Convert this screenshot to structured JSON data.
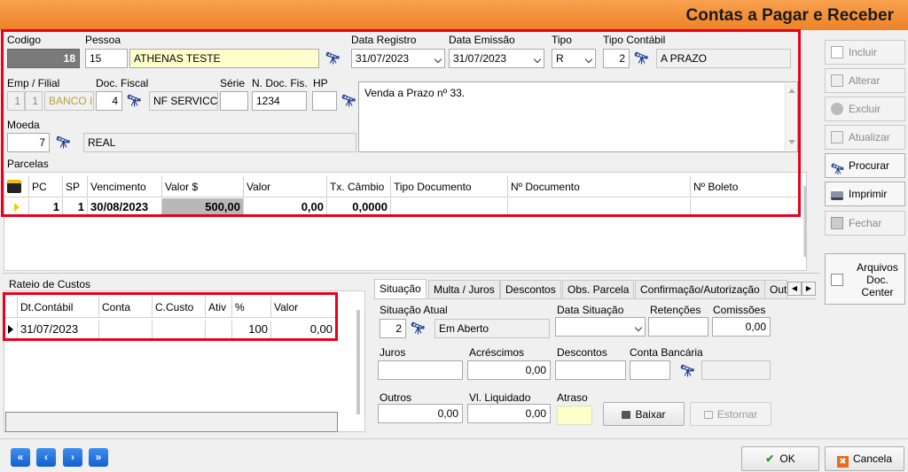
{
  "window": {
    "title": "Contas a Pagar e Receber"
  },
  "header": {
    "codigo": {
      "label": "Codigo",
      "value": "18"
    },
    "pessoa": {
      "label": "Pessoa",
      "code": "15",
      "name": "ATHENAS TESTE"
    },
    "data_registro": {
      "label": "Data Registro",
      "value": "31/07/2023"
    },
    "data_emissao": {
      "label": "Data Emissão",
      "value": "31/07/2023"
    },
    "tipo": {
      "label": "Tipo",
      "value": "R"
    },
    "tipo_contabil": {
      "label": "Tipo Contábil",
      "code": "2",
      "name": "A PRAZO"
    },
    "emp_filial": {
      "label": "Emp / Filial",
      "emp": "1",
      "filial": "1",
      "name": "BANCO I"
    },
    "doc_fiscal": {
      "label": "Doc. Fiscal",
      "code": "4",
      "name": "NF SERVICC"
    },
    "serie": {
      "label": "Série",
      "value": ""
    },
    "n_doc_fis": {
      "label": "N. Doc. Fis.",
      "value": "1234"
    },
    "hp": {
      "label": "HP",
      "value": ""
    },
    "descricao": "Venda a Prazo nº 33.",
    "moeda": {
      "label": "Moeda",
      "code": "7",
      "name": "REAL"
    }
  },
  "parcelas": {
    "label": "Parcelas",
    "columns": [
      "PC",
      "SP",
      "Vencimento",
      "Valor $",
      "Valor",
      "Tx. Câmbio",
      "Tipo Documento",
      "Nº Documento",
      "Nº Boleto"
    ],
    "rows": [
      {
        "pc": "1",
        "sp": "1",
        "vencimento": "30/08/2023",
        "valor_rs": "500,00",
        "valor": "0,00",
        "tx_cambio": "0,0000",
        "tipo_documento": "",
        "n_documento": "",
        "n_boleto": ""
      }
    ]
  },
  "rateio": {
    "label": "Rateio de Custos",
    "columns": [
      "Dt.Contábil",
      "Conta",
      "C.Custo",
      "Ativ",
      "%",
      "Valor"
    ],
    "rows": [
      {
        "dt_contabil": "31/07/2023",
        "conta": "",
        "c_custo": "",
        "ativ": "",
        "pct": "100",
        "valor": "0,00"
      }
    ]
  },
  "tabs": [
    "Situação",
    "Multa / Juros",
    "Descontos",
    "Obs. Parcela",
    "Confirmação/Autorização",
    "Out"
  ],
  "situacao": {
    "situacao_atual": {
      "label": "Situação Atual",
      "code": "2",
      "name": "Em Aberto"
    },
    "data_situacao": {
      "label": "Data Situação",
      "value": ""
    },
    "retencoes": {
      "label": "Retenções",
      "value": ""
    },
    "comissoes": {
      "label": "Comissões",
      "value": "0,00"
    },
    "juros": {
      "label": "Juros",
      "value": ""
    },
    "acrescimos": {
      "label": "Acréscimos",
      "value": "0,00"
    },
    "descontos": {
      "label": "Descontos",
      "value": ""
    },
    "conta_bancaria": {
      "label": "Conta Bancária",
      "code": "",
      "name": ""
    },
    "outros": {
      "label": "Outros",
      "value": "0,00"
    },
    "vl_liquidado": {
      "label": "Vl. Liquidado",
      "value": "0,00"
    },
    "atraso": {
      "label": "Atraso",
      "value": ""
    },
    "baixar": "Baixar",
    "estornar": "Estornar"
  },
  "side": {
    "incluir": "Incluir",
    "alterar": "Alterar",
    "excluir": "Excluir",
    "atualizar": "Atualizar",
    "procurar": "Procurar",
    "imprimir": "Imprimir",
    "fechar": "Fechar",
    "arquivos": "Arquivos Doc. Center"
  },
  "footer": {
    "ok": "OK",
    "cancelar": "Cancela"
  },
  "colors": {
    "title_bar": "#ef8228",
    "highlight_box": "#e8001c",
    "nav": "#1f6fdc"
  }
}
